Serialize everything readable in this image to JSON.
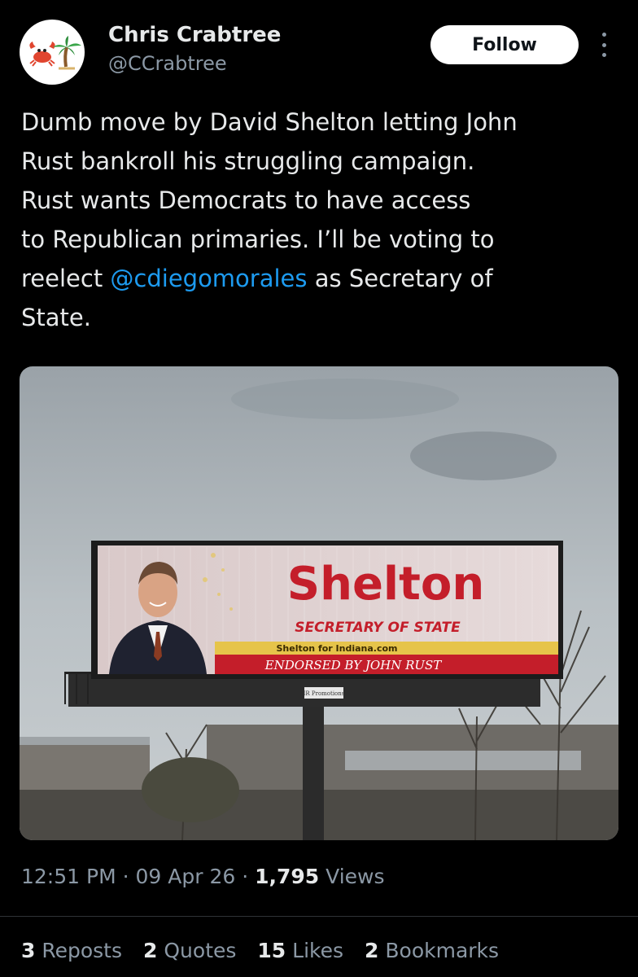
{
  "author": {
    "display_name": "Chris Crabtree",
    "handle": "@CCrabtree",
    "avatar_emoji": "🦀🌴"
  },
  "follow_label": "Follow",
  "tweet": {
    "text_before": "Dumb move by David Shelton letting John\nRust bankroll his struggling campaign.\nRust wants Democrats to have access\nto Republican primaries. I’ll be voting to\nreelect ",
    "mention": "@cdiegomorales",
    "text_after": " as Secretary of\nState."
  },
  "billboard": {
    "name": "Shelton",
    "office": "SECRETARY OF STATE",
    "site": "Shelton for Indiana.com",
    "endorsement": "ENDORSED BY JOHN RUST",
    "vendor": "IR Promotions"
  },
  "meta": {
    "time": "12:51 PM",
    "date": "09 Apr 26",
    "views_count": "1,795",
    "views_label": "Views",
    "sep": " · "
  },
  "stats": {
    "reposts_count": "3",
    "reposts_label": "Reposts",
    "quotes_count": "2",
    "quotes_label": "Quotes",
    "likes_count": "15",
    "likes_label": "Likes",
    "bookmarks_count": "2",
    "bookmarks_label": "Bookmarks"
  },
  "colors": {
    "background": "#000000",
    "text": "#e7e9ea",
    "secondary": "#8b98a5",
    "link": "#1d9bf0",
    "billboard_red": "#c41e2a"
  },
  "icons": {
    "more": "more-vertical-icon"
  }
}
